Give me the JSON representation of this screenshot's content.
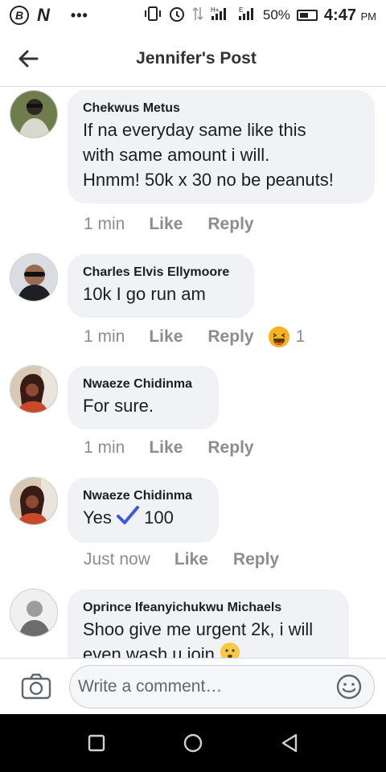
{
  "status_bar": {
    "b_logo": "B",
    "n_logo": "N",
    "dots": "•••",
    "network_1": "H+",
    "network_2": "E",
    "battery": "50%",
    "time": "4:47",
    "ampm": "PM"
  },
  "header": {
    "title": "Jennifer's Post",
    "back_icon": "arrow-left-icon"
  },
  "comments": [
    {
      "name": "Chekwus Metus",
      "lines": [
        "If na everyday same like this",
        "with same  amount i will.",
        "Hnmm! 50k x  30 no be peanuts!"
      ],
      "time": "1 min",
      "like": "Like",
      "reply": "Reply"
    },
    {
      "name": "Charles Elvis Ellymoore",
      "lines": [
        "10k I go run am"
      ],
      "time": "1 min",
      "like": "Like",
      "reply": "Reply",
      "reaction_icon": "laughing-emoji-icon",
      "reaction_count": "1"
    },
    {
      "name": "Nwaeze Chidinma",
      "lines": [
        "For sure."
      ],
      "time": "1 min",
      "like": "Like",
      "reply": "Reply"
    },
    {
      "name": "Nwaeze Chidinma",
      "text_before": "Yes",
      "text_after": "100",
      "check_icon": "check-mark-icon",
      "time": "Just now",
      "like": "Like",
      "reply": "Reply"
    },
    {
      "name": "Oprince Ifeanyichukwu Michaels",
      "lines": [
        "Shoo give me urgent 2k, i will",
        "even wash u join"
      ],
      "emoji": "smiley-emoji-icon"
    }
  ],
  "composer": {
    "placeholder": "Write a comment…",
    "camera_icon": "camera-icon",
    "emoji_icon": "smiley-icon"
  },
  "nav": {
    "recents_icon": "square-icon",
    "home_icon": "circle-icon",
    "back_icon": "triangle-back-icon"
  },
  "colors": {
    "bubble": "#f0f2f5",
    "meta_text": "#8a8d91",
    "check_blue": "#3b5bdb",
    "reaction_yellow": "#f7b125"
  }
}
